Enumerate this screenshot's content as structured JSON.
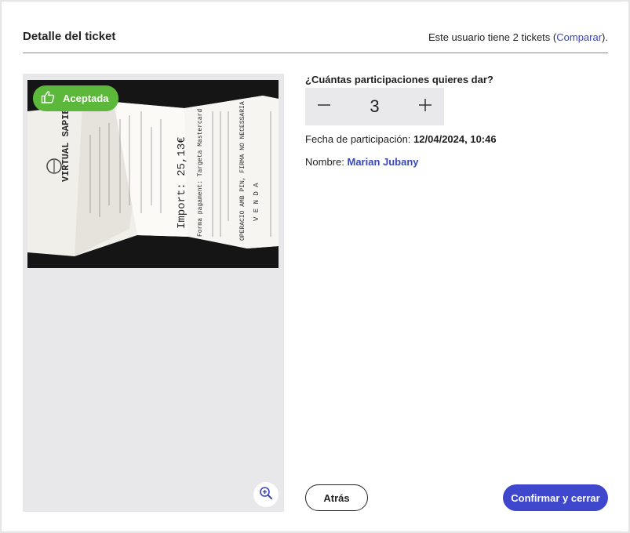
{
  "header": {
    "title": "Detalle del ticket",
    "tickets_prefix": "Este usuario tiene 2 tickets (",
    "compare_link": "Comparar",
    "tickets_suffix": ")."
  },
  "image_panel": {
    "status_badge": "Aceptada",
    "status_color": "#5bb83a",
    "receipt": {
      "brand": "VIRTUAL SAPIENS",
      "import": "Import: 25,13€",
      "payment": "Forma pagament: Targeta Mastercard",
      "signature": "OPERACIO AMB PIN, FIRMA NO NECESSARIA",
      "venda": "V E N D A"
    },
    "zoom_icon": "zoom-in-icon"
  },
  "form": {
    "question": "¿Cuántas participaciones quieres dar?",
    "participations": "3",
    "date_label": "Fecha de participación:",
    "date_value": "12/04/2024, 10:46",
    "name_label": "Nombre:",
    "name_value": "Marian Jubany"
  },
  "actions": {
    "back_label": "Atrás",
    "confirm_label": "Confirmar y cerrar"
  },
  "colors": {
    "accent": "#3f48cc",
    "link": "#3a47b8",
    "accepted": "#5bb83a"
  }
}
